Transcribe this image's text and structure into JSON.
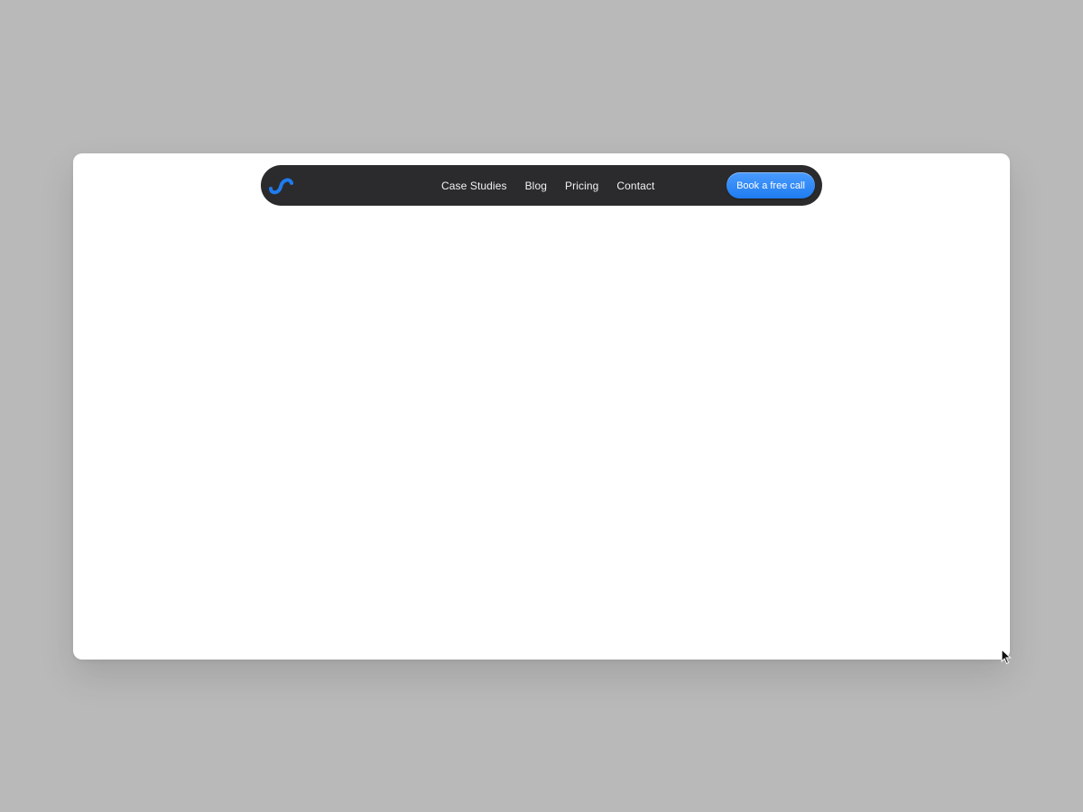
{
  "nav": {
    "logo_icon": "wave-s-logo-icon",
    "links": [
      {
        "label": "Case Studies"
      },
      {
        "label": "Blog"
      },
      {
        "label": "Pricing"
      },
      {
        "label": "Contact"
      }
    ],
    "cta_label": "Book a free call"
  },
  "colors": {
    "backdrop": "#b9b9b9",
    "card": "#ffffff",
    "navbar": "#2b2b2d",
    "accent": "#1f7cf0",
    "nav_text": "#f2f2f2"
  },
  "cursor_icon": "mouse-pointer-icon"
}
